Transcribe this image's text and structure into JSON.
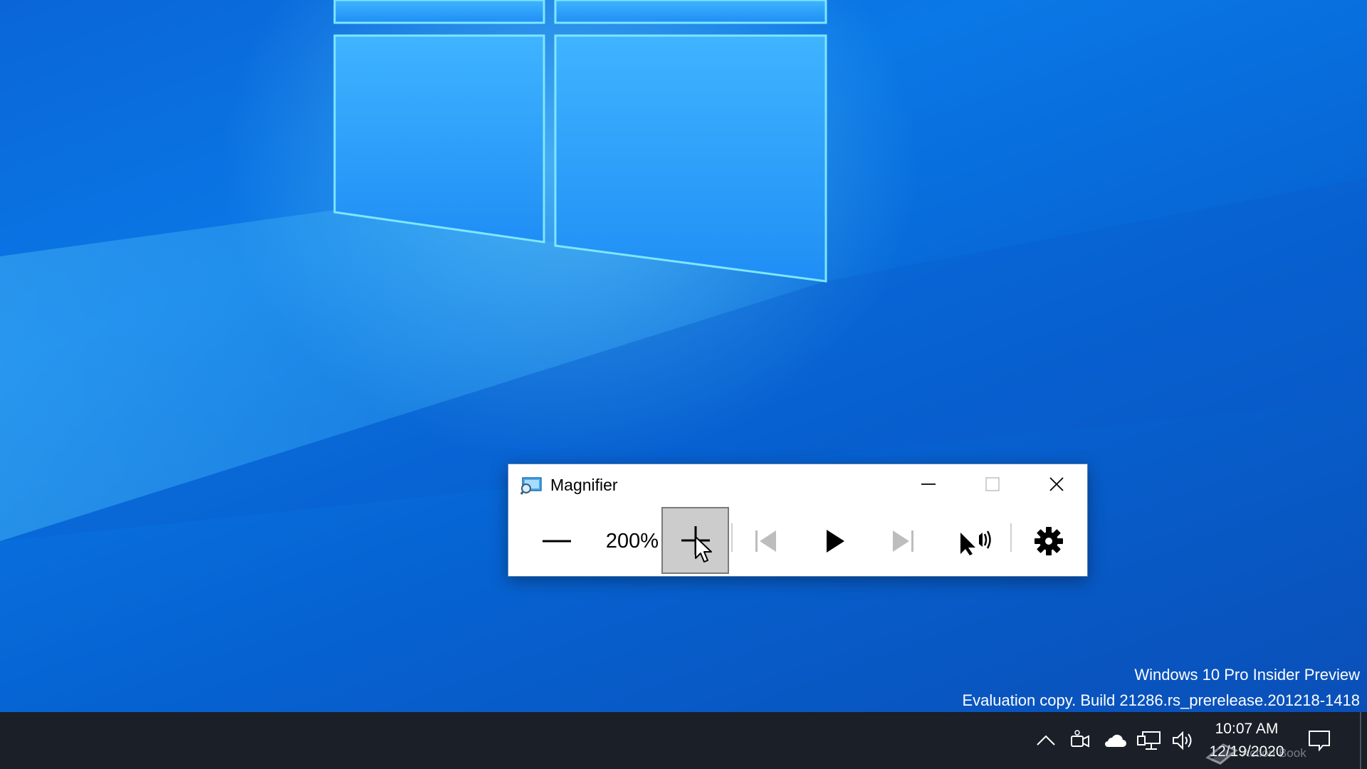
{
  "desktop": {
    "watermark_line1": "Windows 10 Pro Insider Preview",
    "watermark_line2": "Evaluation copy. Build 21286.rs_prerelease.201218-1418"
  },
  "magnifier": {
    "title": "Magnifier",
    "app_icon": "magnifier-app-icon",
    "caption_buttons": {
      "minimize_icon": "minimize-icon",
      "maximize_icon": "maximize-icon",
      "close_icon": "close-icon"
    },
    "toolbar": {
      "zoom_out_icon": "minus-icon",
      "zoom_level": "200%",
      "zoom_in_icon": "plus-icon",
      "previous_icon": "skip-previous-icon",
      "play_icon": "play-icon",
      "next_icon": "skip-next-icon",
      "read_from_here_icon": "read-from-here-icon",
      "settings_icon": "gear-icon"
    }
  },
  "taskbar": {
    "tray_icons": [
      "chevron-up-icon",
      "meet-now-icon",
      "onedrive-icon",
      "network-icon",
      "volume-icon"
    ],
    "clock_time": "10:07 AM",
    "clock_date": "12/19/2020",
    "brand_overlay": "Action Book",
    "action_center_icon": "notification-icon"
  },
  "colors": {
    "desktop_blue": "#0a6fe0",
    "taskbar": "#1a1f28",
    "zoom_in_pressed": "#cccccc"
  }
}
